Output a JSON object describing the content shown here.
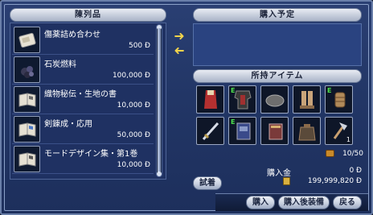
{
  "headers": {
    "goods": "陳列品",
    "plan": "購入予定",
    "inventory": "所持アイテム"
  },
  "currency_symbol": "Ð",
  "goods": [
    {
      "name": "傷薬詰め合わせ",
      "price": "500 Ð",
      "icon": "medicine-pack-icon"
    },
    {
      "name": "石炭燃料",
      "price": "100,000 Ð",
      "icon": "coal-icon"
    },
    {
      "name": "織物秘伝・生地の書",
      "price": "10,000 Ð",
      "icon": "book-icon"
    },
    {
      "name": "剣錬成・応用",
      "price": "50,000 Ð",
      "icon": "book-icon"
    },
    {
      "name": "モードデザイン集・第1巻",
      "price": "10,000 Ð",
      "icon": "book-icon"
    }
  ],
  "inventory": {
    "row1": [
      {
        "icon": "red-cape-icon",
        "equipped": false
      },
      {
        "icon": "armor-icon",
        "equipped": true,
        "mark": "E"
      },
      {
        "icon": "helmet-icon",
        "equipped": false
      },
      {
        "icon": "boots-icon",
        "equipped": false
      },
      {
        "icon": "gloves-icon",
        "equipped": true,
        "mark": "E"
      }
    ],
    "row2": [
      {
        "icon": "sword-icon",
        "equipped": false
      },
      {
        "icon": "book-icon",
        "equipped": true,
        "mark": "E"
      },
      {
        "icon": "book-icon",
        "equipped": false
      },
      {
        "icon": "bag-icon",
        "equipped": false
      },
      {
        "icon": "tool-icon",
        "equipped": false,
        "qty": "1"
      }
    ]
  },
  "capacity": "10/50",
  "purchase_label": "購入金",
  "purchase_amount": "0 Ð",
  "money": "199,999,820 Ð",
  "buttons": {
    "try_on": "試着",
    "buy": "購入",
    "buy_equip": "購入後装備",
    "back": "戻る"
  }
}
